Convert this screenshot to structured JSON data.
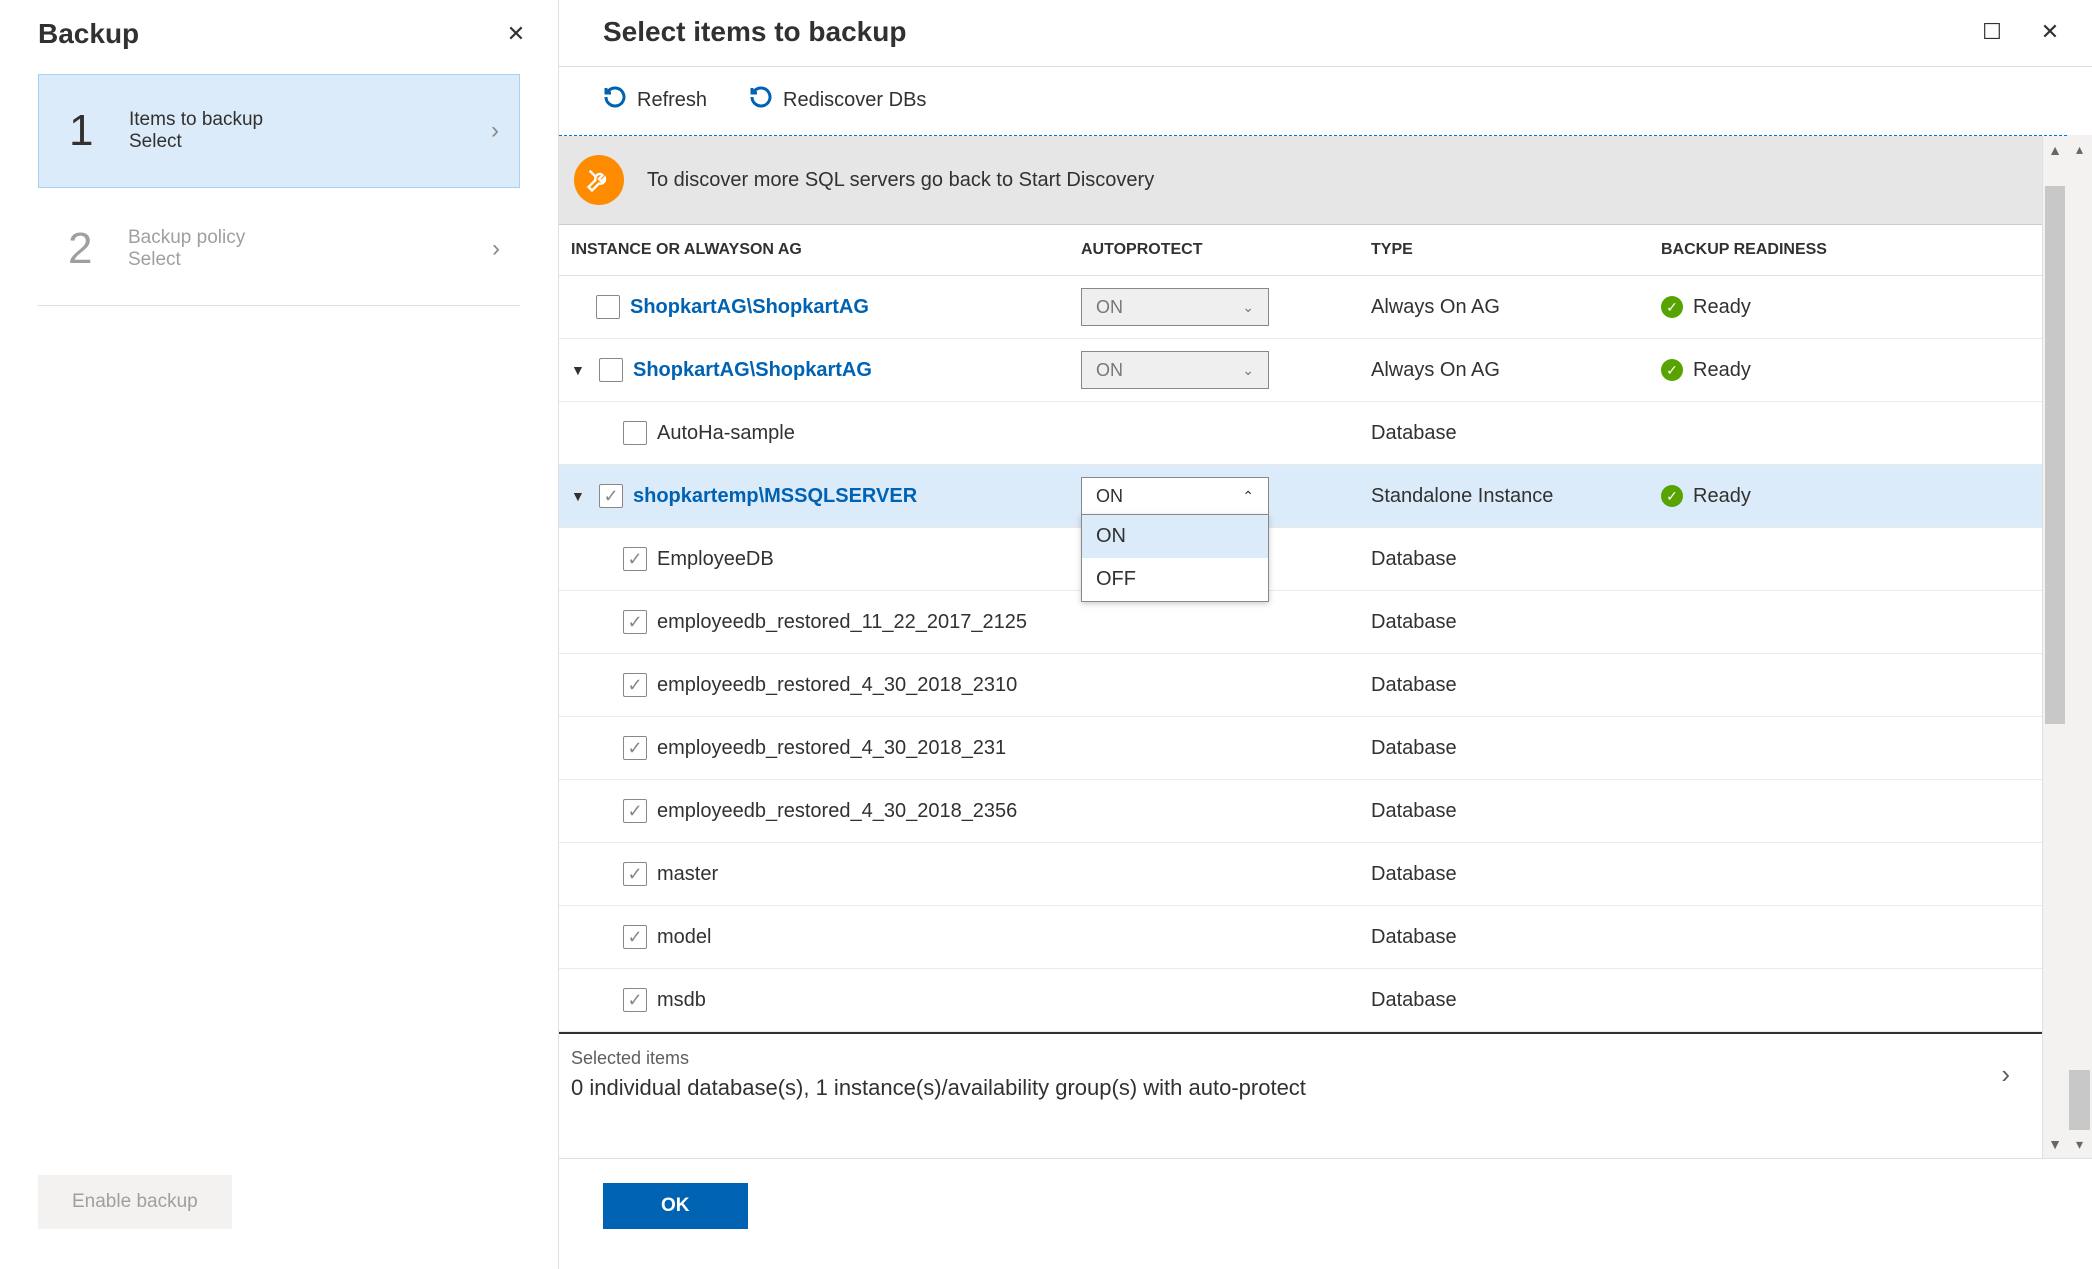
{
  "left": {
    "title": "Backup",
    "steps": [
      {
        "label": "Items to backup",
        "sub": "Select"
      },
      {
        "label": "Backup policy",
        "sub": "Select"
      }
    ],
    "enable_button": "Enable backup"
  },
  "right": {
    "title": "Select items to backup",
    "toolbar": {
      "refresh": "Refresh",
      "rediscover": "Rediscover DBs"
    },
    "banner": "To discover more SQL servers go back to Start Discovery",
    "columns": {
      "instance": "Instance or AlwaysOn AG",
      "autoprotect": "Autoprotect",
      "type": "Type",
      "ready": "Backup Readiness"
    },
    "autoprotect_options": {
      "on": "ON",
      "off": "OFF"
    },
    "rows": [
      {
        "name": "ShopkartAG\\ShopkartAG",
        "link": true,
        "checked": false,
        "autoprotect": "ON",
        "apEnabled": false,
        "type": "Always On AG",
        "ready": "Ready",
        "expand": null
      },
      {
        "name": "ShopkartAG\\ShopkartAG",
        "link": true,
        "checked": false,
        "autoprotect": "ON",
        "apEnabled": false,
        "type": "Always On AG",
        "ready": "Ready",
        "expand": "down"
      },
      {
        "name": "AutoHa-sample",
        "indent": 2,
        "checked": false,
        "type": "Database"
      },
      {
        "name": "shopkartemp\\MSSQLSERVER",
        "link": true,
        "checked": true,
        "autoprotect": "ON",
        "apEnabled": true,
        "apOpen": true,
        "type": "Standalone Instance",
        "ready": "Ready",
        "expand": "down",
        "selected": true
      },
      {
        "name": "EmployeeDB",
        "indent": 2,
        "checked": true,
        "type": "Database"
      },
      {
        "name": "employeedb_restored_11_22_2017_2125",
        "indent": 2,
        "checked": true,
        "type": "Database"
      },
      {
        "name": "employeedb_restored_4_30_2018_2310",
        "indent": 2,
        "checked": true,
        "type": "Database"
      },
      {
        "name": "employeedb_restored_4_30_2018_231",
        "indent": 2,
        "checked": true,
        "type": "Database"
      },
      {
        "name": "employeedb_restored_4_30_2018_2356",
        "indent": 2,
        "checked": true,
        "type": "Database"
      },
      {
        "name": "master",
        "indent": 2,
        "checked": true,
        "type": "Database"
      },
      {
        "name": "model",
        "indent": 2,
        "checked": true,
        "type": "Database"
      },
      {
        "name": "msdb",
        "indent": 2,
        "checked": true,
        "type": "Database"
      }
    ],
    "summary": {
      "label": "Selected items",
      "text": "0 individual database(s), 1 instance(s)/availability group(s) with auto-protect"
    },
    "ok": "OK"
  }
}
